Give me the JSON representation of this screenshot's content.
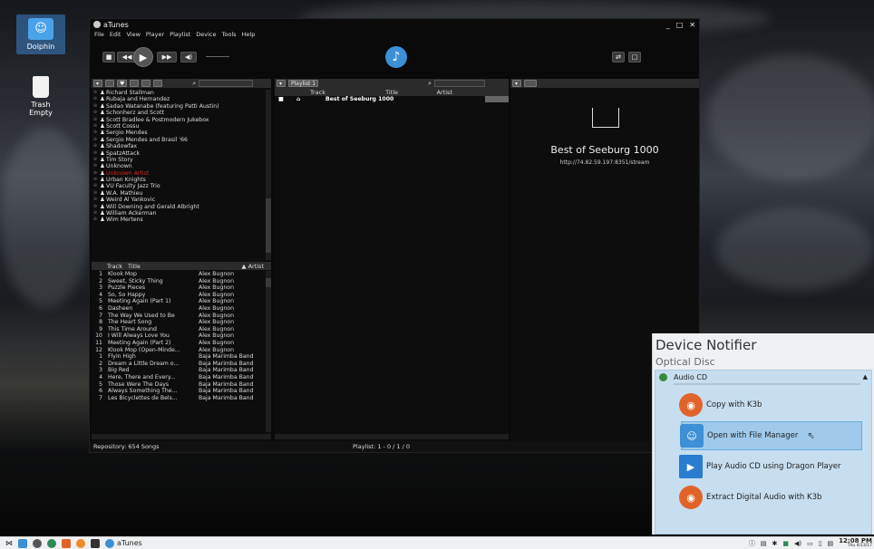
{
  "desktop": {
    "dolphin_label": "Dolphin",
    "trash_label_1": "Trash",
    "trash_label_2": "Empty"
  },
  "window": {
    "title": "aTunes",
    "menu": [
      "File",
      "Edit",
      "View",
      "Player",
      "Playlist",
      "Device",
      "Tools",
      "Help"
    ]
  },
  "navigator": {
    "artists": [
      {
        "name": "Richard Stallman",
        "red": false
      },
      {
        "name": "Rubaja and Hernandez",
        "red": false
      },
      {
        "name": "Sadao Watanabe (featuring Patti Austin)",
        "red": false
      },
      {
        "name": "Schonherz and Scott",
        "red": false
      },
      {
        "name": "Scott Bradlee & Postmodern Jukebox",
        "red": false
      },
      {
        "name": "Scott Cossu",
        "red": false
      },
      {
        "name": "Sergio Mendes",
        "red": false
      },
      {
        "name": "Sergio Mendes and Brasil '66",
        "red": false
      },
      {
        "name": "Shadowfax",
        "red": false
      },
      {
        "name": "SpatzAttack",
        "red": false
      },
      {
        "name": "Tim Story",
        "red": false
      },
      {
        "name": "Unknown",
        "red": false
      },
      {
        "name": "Unknown Artist",
        "red": true
      },
      {
        "name": "Urban Knights",
        "red": false
      },
      {
        "name": "VU Faculty Jazz Trio",
        "red": false
      },
      {
        "name": "W.A. Mathieu",
        "red": false
      },
      {
        "name": "Weird Al Yankovic",
        "red": false
      },
      {
        "name": "Will Downing and Gerald Albright",
        "red": false
      },
      {
        "name": "William Ackerman",
        "red": false
      },
      {
        "name": "Wim Mertens",
        "red": false
      }
    ],
    "col_track": "Track",
    "col_title": "Title",
    "col_artist": "▲ Artist",
    "songs": [
      {
        "n": "1",
        "t": "Klook Mop",
        "a": "Alex Bugnon"
      },
      {
        "n": "2",
        "t": "Sweet, Sticky Thing",
        "a": "Alex Bugnon"
      },
      {
        "n": "3",
        "t": "Puzzle Pieces",
        "a": "Alex Bugnon"
      },
      {
        "n": "4",
        "t": "So, So Happy",
        "a": "Alex Bugnon"
      },
      {
        "n": "5",
        "t": "Meeting Again (Part 1)",
        "a": "Alex Bugnon"
      },
      {
        "n": "6",
        "t": "Dasheen",
        "a": "Alex Bugnon"
      },
      {
        "n": "7",
        "t": "The Way We Used to Be",
        "a": "Alex Bugnon"
      },
      {
        "n": "8",
        "t": "The Heart Song",
        "a": "Alex Bugnon"
      },
      {
        "n": "9",
        "t": "This Time Around",
        "a": "Alex Bugnon"
      },
      {
        "n": "10",
        "t": "I Will Always Love You",
        "a": "Alex Bugnon"
      },
      {
        "n": "11",
        "t": "Meeting Again (Part 2)",
        "a": "Alex Bugnon"
      },
      {
        "n": "12",
        "t": "Klook Mop (Open-Minde...",
        "a": "Alex Bugnon"
      },
      {
        "n": "1",
        "t": "Flyin High",
        "a": "Baja Marimba Band"
      },
      {
        "n": "2",
        "t": "Dream a Little Dream o...",
        "a": "Baja Marimba Band"
      },
      {
        "n": "3",
        "t": "Big Red",
        "a": "Baja Marimba Band"
      },
      {
        "n": "4",
        "t": "Here, There and Every...",
        "a": "Baja Marimba Band"
      },
      {
        "n": "5",
        "t": "Those Were The Days",
        "a": "Baja Marimba Band"
      },
      {
        "n": "6",
        "t": "Always Something The...",
        "a": "Baja Marimba Band"
      },
      {
        "n": "7",
        "t": "Les Bicyclettes de Bels...",
        "a": "Baja Marimba Band"
      }
    ]
  },
  "playlist": {
    "tab": "Playlist 1",
    "col_track": "Track",
    "col_title": "Title",
    "col_artist": "Artist",
    "rows": [
      {
        "title": "Best of Seeburg 1000"
      }
    ]
  },
  "context": {
    "station": "Best of Seeburg 1000",
    "url": "http://74.82.59.197:8351/stream"
  },
  "status": {
    "repository": "Repository: 654 Songs",
    "playlist": "Playlist: 1 - 0 / 1 / 0"
  },
  "notifier": {
    "title": "Device Notifier",
    "subtitle": "Optical Disc",
    "device": "Audio CD",
    "actions": [
      "Copy with K3b",
      "Open with File Manager",
      "Play Audio CD using Dragon Player",
      "Extract Digital Audio with K3b"
    ]
  },
  "taskbar": {
    "task": "aTunes",
    "time": "12:08 PM",
    "date": "Thu 4/13/17"
  },
  "colors": {
    "accent": "#3d8fd6",
    "red_artist": "#e02020",
    "notifier_selected": "#9fcaeb"
  }
}
